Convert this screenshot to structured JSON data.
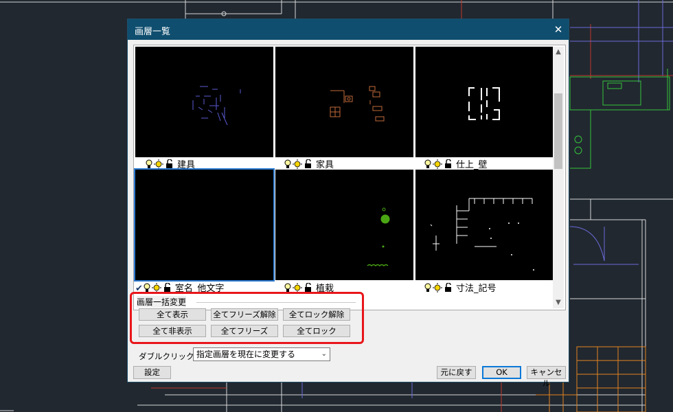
{
  "dialog": {
    "title": "画層一覧",
    "close_label": "✕"
  },
  "layers": [
    {
      "name": "建具",
      "current": false,
      "wire": "#5b5bd6"
    },
    {
      "name": "家具",
      "current": false,
      "wire": "#c26a3a"
    },
    {
      "name": "仕上_壁",
      "current": false,
      "wire": "#ffffff"
    },
    {
      "name": "室名_他文字",
      "current": true,
      "wire": "#000000"
    },
    {
      "name": "植栽",
      "current": false,
      "wire": "#4ba614"
    },
    {
      "name": "寸法_記号",
      "current": false,
      "wire": "#ffffff"
    }
  ],
  "layer_icons": [
    "bulb-icon",
    "sun-icon",
    "lock-icon"
  ],
  "current_mark": "✔",
  "bulk_change": {
    "title": "画層一括変更",
    "show_all": "全て表示",
    "unfreeze_all": "全てフリーズ解除",
    "unlock_all": "全てロック解除",
    "hide_all": "全て非表示",
    "freeze_all": "全てフリーズ",
    "lock_all": "全てロック"
  },
  "double_click": {
    "label": "ダブルクリック:",
    "selected": "指定画層を現在に変更する"
  },
  "footer": {
    "settings": "設定",
    "undo": "元に戻す",
    "ok": "OK",
    "cancel": "キャンセル"
  },
  "colors": {
    "title_bar": "#0f4e6f",
    "highlight": "#e8161b",
    "cad_background": "#212830",
    "selection": "#2d7bd1"
  }
}
